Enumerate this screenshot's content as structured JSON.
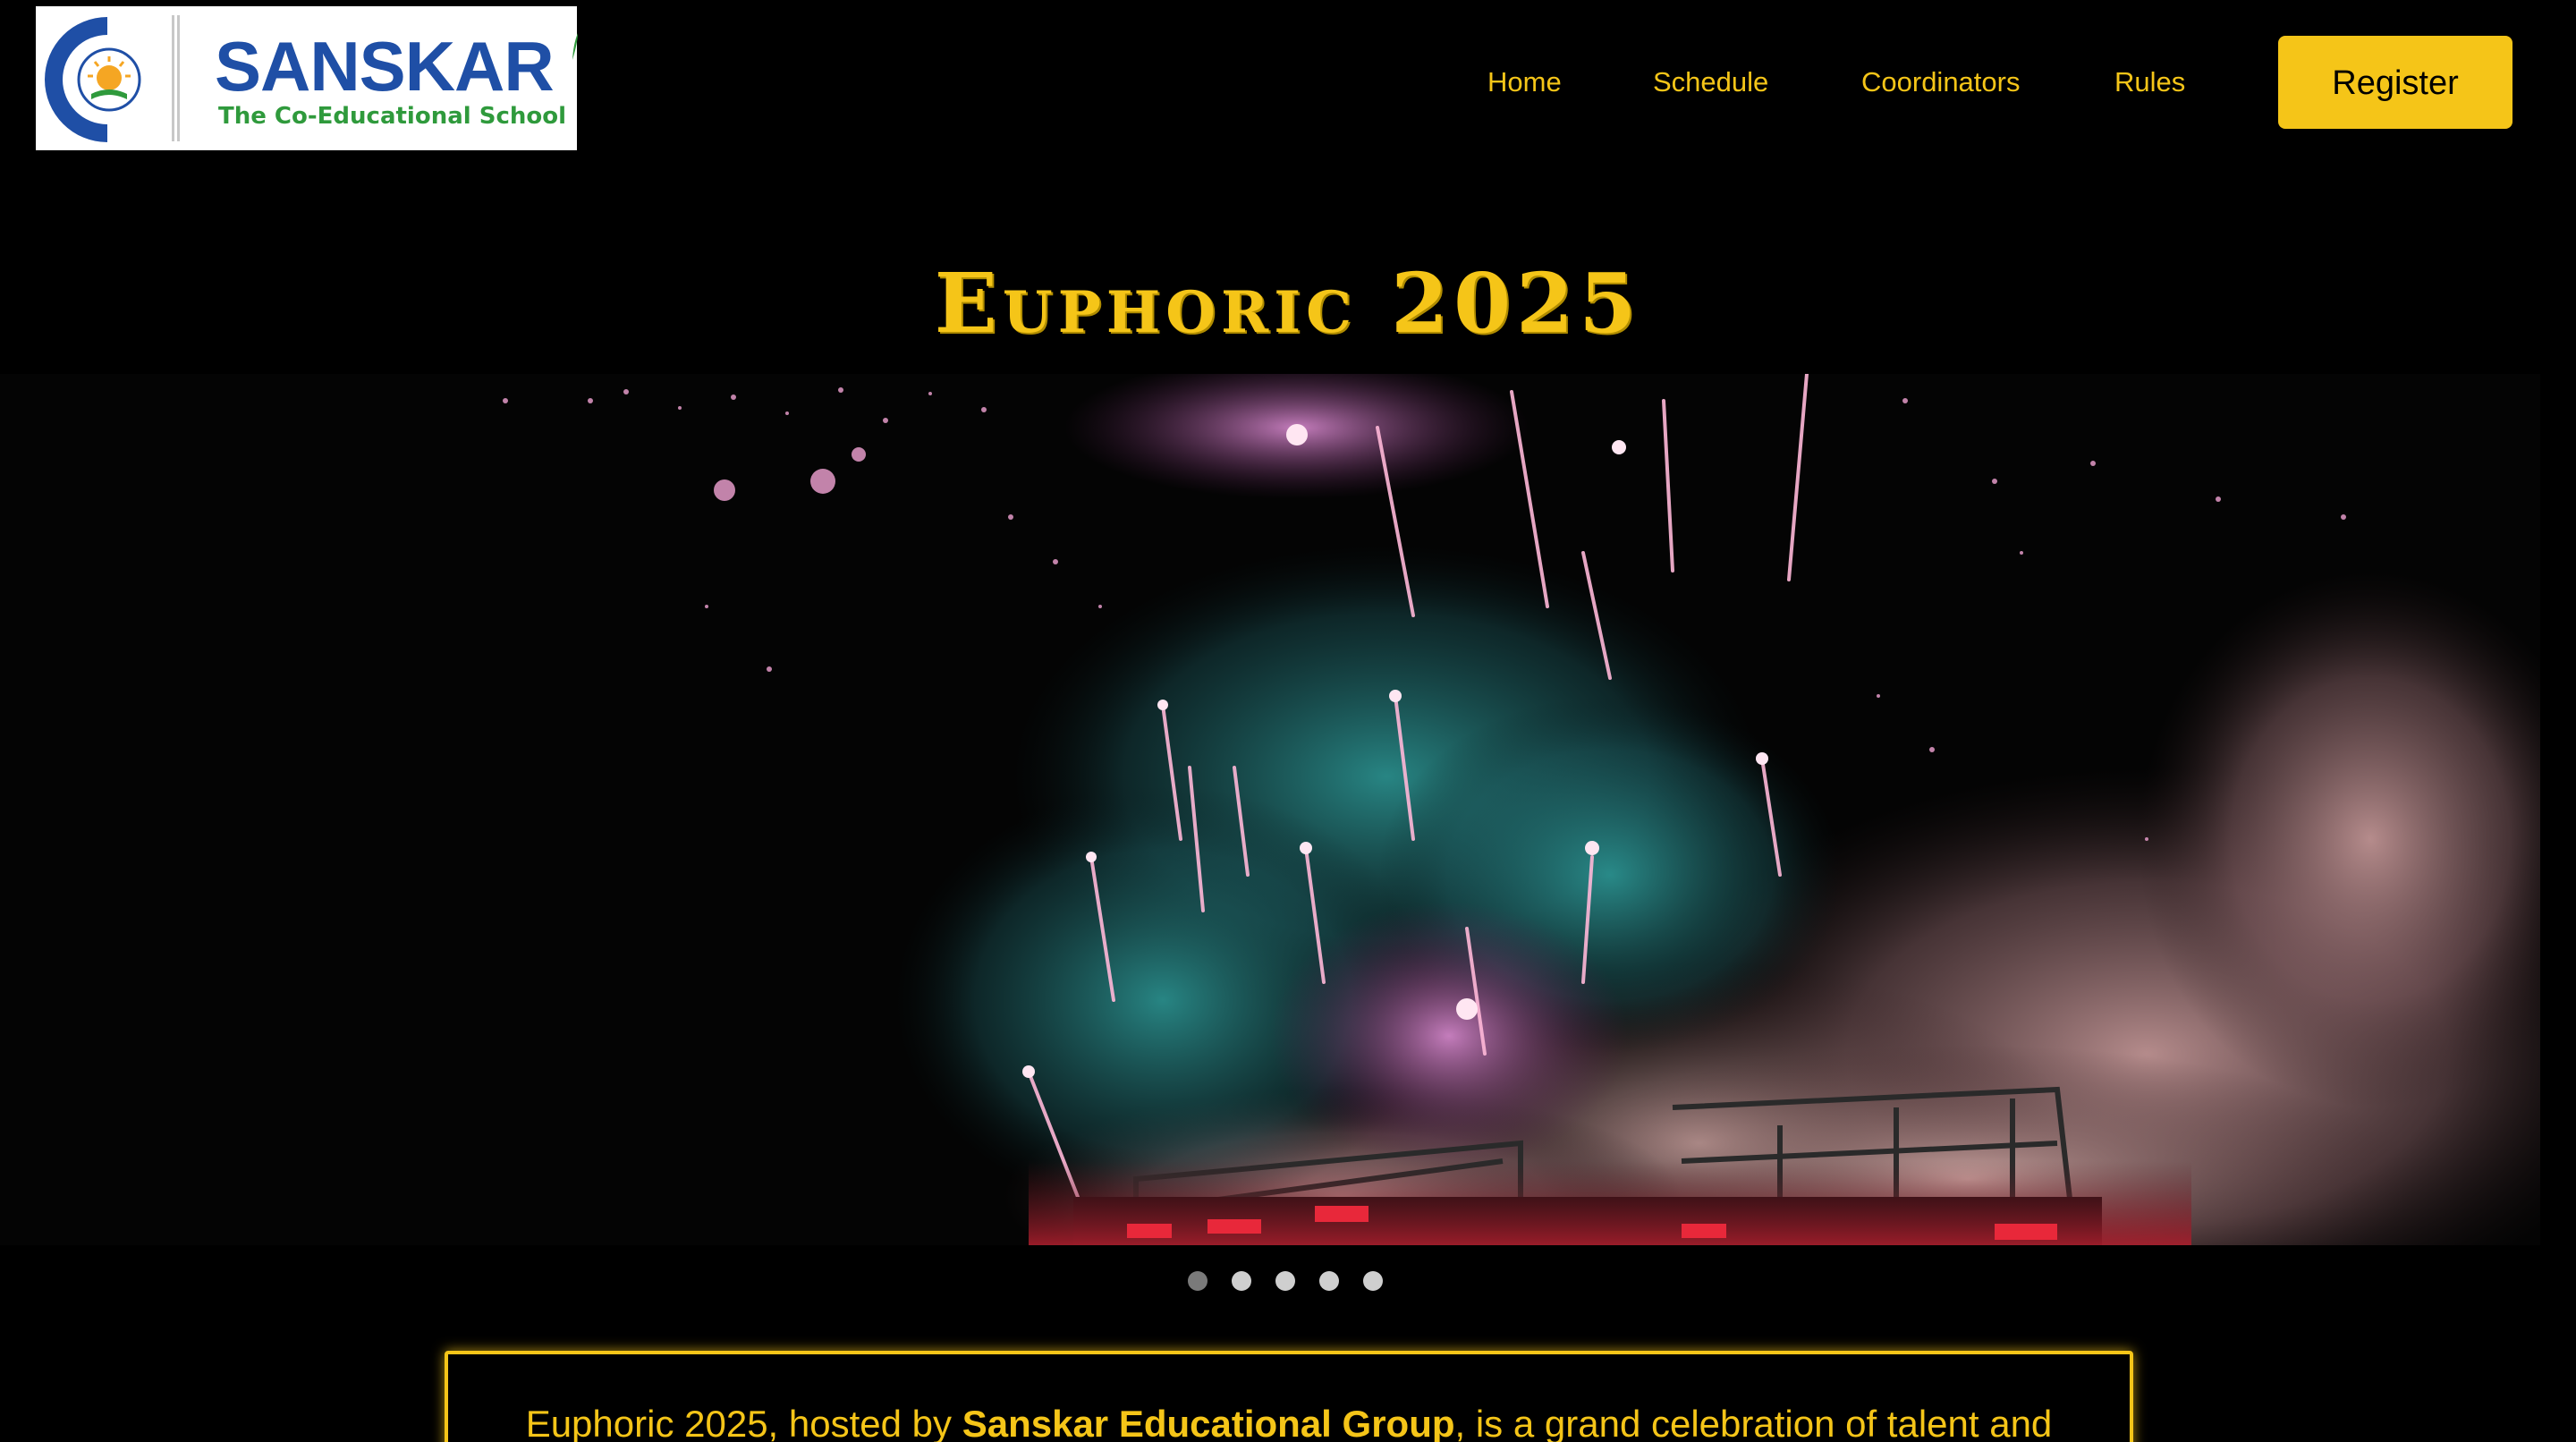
{
  "header": {
    "logo": {
      "name": "SANSKAR",
      "tagline": "The Co-Educational School",
      "emblem_icon": "sun-emblem-icon"
    },
    "nav": [
      {
        "label": "Home"
      },
      {
        "label": "Schedule"
      },
      {
        "label": "Coordinators"
      },
      {
        "label": "Rules"
      }
    ],
    "register_label": "Register"
  },
  "hero": {
    "title": "Euphoric 2025"
  },
  "slider": {
    "image": "fireworks-night-sky-image",
    "slide_count": 5,
    "active_index": 0
  },
  "about": {
    "text_prefix": "Euphoric 2025, hosted by ",
    "host": "Sanskar Educational Group",
    "text_suffix": ", is a grand celebration of talent and"
  },
  "colors": {
    "background": "#000000",
    "accent": "#f5c518",
    "logo_blue": "#1f4fa6",
    "logo_green": "#2f9a3c",
    "dot_inactive": "#cfcfcf",
    "dot_active": "#7a7a7a"
  }
}
